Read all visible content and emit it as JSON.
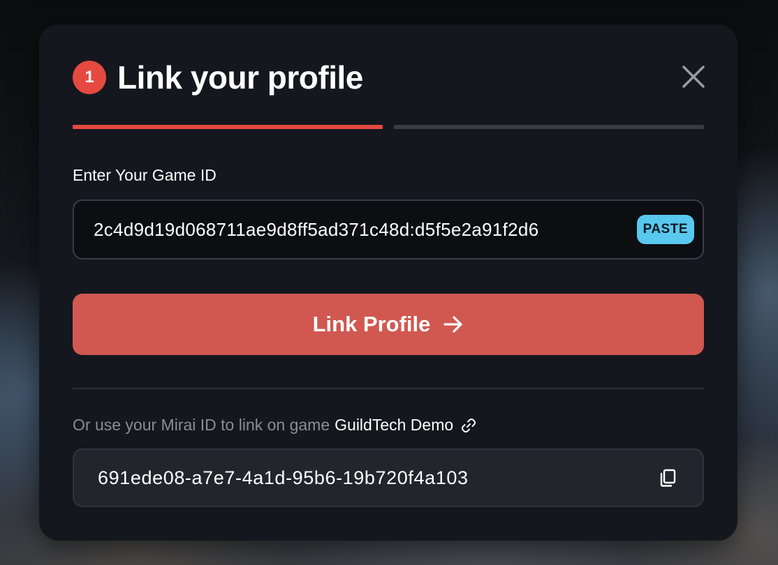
{
  "modal": {
    "step_number": "1",
    "title": "Link your profile",
    "close_icon": "close-icon",
    "progress": {
      "total_steps": 2,
      "current_step": 1
    },
    "colors": {
      "accent": "#e6493f",
      "button": "#d05850",
      "paste": "#59c8ee",
      "background": "#15171e"
    }
  },
  "game_id": {
    "label": "Enter Your Game ID",
    "value": "2c4d9d19d068711ae9d8ff5ad371c48d:d5f5e2a91f2d6",
    "paste_label": "PASTE"
  },
  "primary_button": {
    "label": "Link Profile",
    "icon": "arrow-right-icon"
  },
  "alternative": {
    "prefix": "Or use your Mirai ID to link on game",
    "game_name": "GuildTech Demo",
    "link_icon": "external-link-icon",
    "mirai_id": "691ede08-a7e7-4a1d-95b6-19b720f4a103",
    "copy_icon": "copy-icon"
  }
}
